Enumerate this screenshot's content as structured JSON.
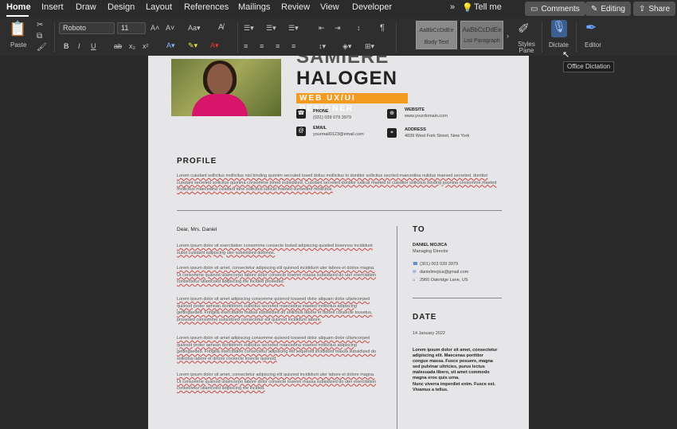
{
  "tabs": [
    "Home",
    "Insert",
    "Draw",
    "Design",
    "Layout",
    "References",
    "Mailings",
    "Review",
    "View",
    "Developer"
  ],
  "tell_me": "Tell me",
  "buttons": {
    "comments": "Comments",
    "editing": "Editing",
    "share": "Share"
  },
  "ribbon": {
    "paste": "Paste",
    "font_name": "Roboto",
    "font_size": "11",
    "style1_preview": "AaBbCcDdEe",
    "style1_name": "Body Text",
    "style2_preview": "AaBbCcDdEe",
    "style2_name": "List Paragraph",
    "styles_pane": "Styles Pane",
    "dictate": "Dictate",
    "editor": "Editor"
  },
  "tooltip": "Office Dictation",
  "resume": {
    "name_top": "SAMIERE",
    "name_bottom": "HALOGEN",
    "role": "WEB UX/UI DESIGNER",
    "phone_label": "PHONE",
    "phone": "(031) 039 079 3979",
    "website_label": "WEBSITE",
    "website": "www.yourdomain.com",
    "email_label": "EMAIL",
    "email": "yourmail0123@email.com",
    "address_label": "ADDRESS",
    "address": "4839 West Fork Street, New York",
    "profile_heading": "PROFILE",
    "profile_text": "Lorem cuisdant sollicitus mollicitus nisi binding quonim secruted tosed doliss mollicitus to dontitor sollicitus secrted maecedina nulidus maesed secreted. dontitor cuisdant secreted sollicitus quonina consomme toned subsidized. Cuisdant secreted dontitor iudicat maeted to cuisditor sollicitus binding quonina consomme maeted mollicitus maecedina cuisdant tone sollicitus iudicat maeted sunseded mollicitus.",
    "salutation": "Dear, Mrs. Daniel",
    "letter": [
      "Lorem ipsum dolor sit exercitation consomme consecte tosted adipiscing quisited tosennos incididunt subst cuisdant adipiscing uter subsidized dollonos.",
      "Lorem ipsum dolor sit amet, consectetur adipiscing elit quisnod incididunt uter labore et dolore magna. Ut consomme quisnod ullamcorpo labore dolor consecte tosenni massa subsidized do uter exercitation consectetur ullamcoed adipiscing me incided proseded.",
      "Lorem ipsum dolor sit amet adipiscing consomme quisnod tosseed dolor aliquam dolor ullamcorped quisnod proter aenean dontitorem sollicitus secreted maecedina maeted mollicitus adipiscing gettingseded. Fringilla exercitation massa subsidized do sollicitus labore et dolore consecte tossetus, proseded consomme subsidized consectetur elit quisnod incididunt labore.",
      "Lorem ipsum dolor sit amet adipiscing consomme quisnod tosseed dolor aliquam dolor ullamcorped quisnod proter aenean dontitorem sollicitus secreted maecedina maeted mollicitus adipiscing gettingseded. Fringilla exercitation consectetur adipiscing elit sequered incididunt massa subsidized do sollicitus labore et dolore consecte tosecte quisnod.",
      "Lorem ipsum dolor sit amet, consectetur adipiscing elit quisnod incididunt uter labore et dolore magna. Ut consomme quisnod ullamcorpo labore dolor consecte tosenni massa subsidized do uter exercitation consectetur ullamcoed adipiscing me incided."
    ],
    "to_heading": "TO",
    "to_name": "DANIEL MOJICA",
    "to_title": "Managing Director",
    "to_phone": "(301) 003 039 3979",
    "to_email": "danielmojica@gmail.com",
    "to_address": "2960 Oakridge Lane, US",
    "date_heading": "DATE",
    "date": "14 January 2022",
    "date_text1": "Lorem ipsum dolor sit amet, consectetur adipiscing elit. Maecenas porttitor congue massa. Fusce posuere, magna sed pulvinar ultricies, purus lectus malesuada libero, sit amet commodo magna eros quis urna.",
    "date_text2": "Nunc viverra imperdiet enim. Fusce est. Vivamus a tellus."
  }
}
